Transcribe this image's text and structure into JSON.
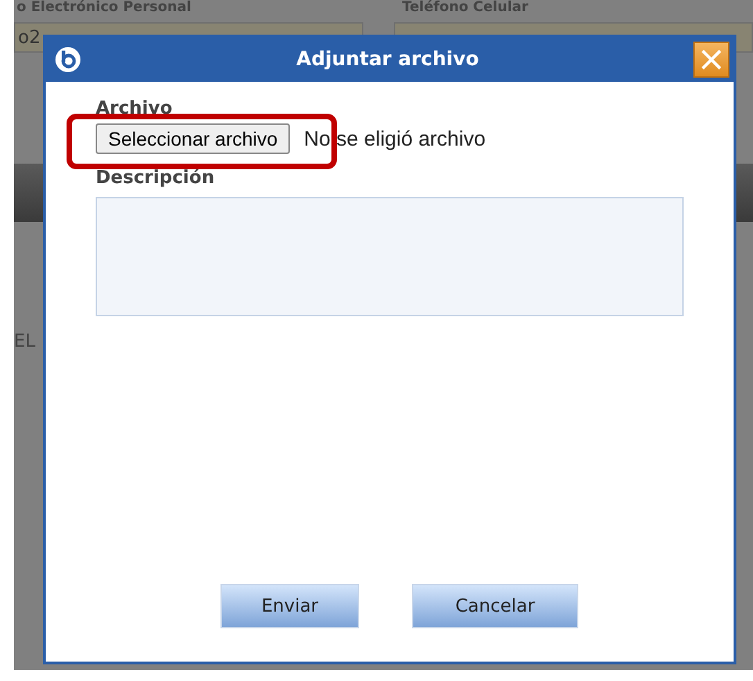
{
  "background": {
    "labels": [
      "o Electrónico Personal",
      "Teléfono Celular"
    ],
    "field_value": "o2",
    "side_text": "EL"
  },
  "dialog": {
    "title": "Adjuntar archivo",
    "file_label": "Archivo",
    "file_button": "Seleccionar archivo",
    "file_status": "No se eligió archivo",
    "highlighted": true,
    "description_label": "Descripción",
    "buttons": [
      "Enviar",
      "Cancelar"
    ]
  }
}
